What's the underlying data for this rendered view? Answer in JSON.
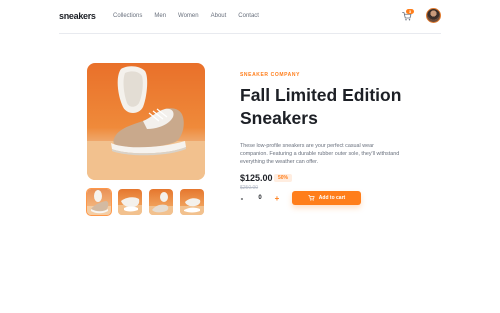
{
  "header": {
    "logo": "sneakers",
    "nav": [
      "Collections",
      "Men",
      "Women",
      "About",
      "Contact"
    ],
    "cart_count": "3",
    "cart_icon": "cart-icon",
    "avatar_icon": "avatar"
  },
  "product": {
    "company": "SNEAKER COMPANY",
    "title_line1": "Fall Limited Edition",
    "title_line2": "Sneakers",
    "description": "These low-profile sneakers are your perfect casual wear companion. Featuring a durable rubber outer sole, they'll withstand everything the weather can offer.",
    "price": "$125.00",
    "discount": "50%",
    "old_price": "$250.00",
    "quantity": "0",
    "minus": "-",
    "plus": "+",
    "add_to_cart": "Add to cart"
  },
  "gallery": {
    "thumbnails": 4,
    "selected": 1
  },
  "colors": {
    "accent": "#ff7e1b",
    "accent_pale": "#ffede0",
    "text_dark": "#1d2026",
    "text_muted": "#69707d"
  }
}
